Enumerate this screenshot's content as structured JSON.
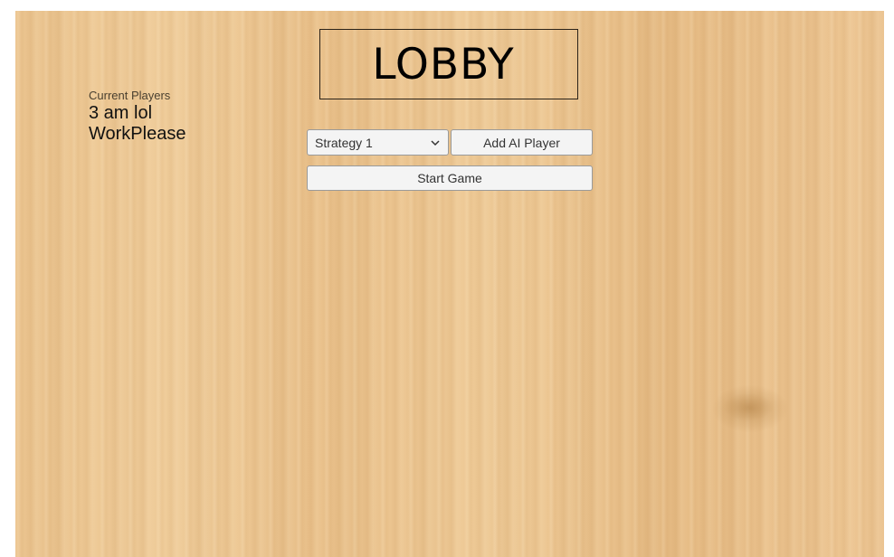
{
  "lobby": {
    "title": "LOBBY"
  },
  "players": {
    "heading": "Current Players",
    "names": [
      "3 am lol",
      "WorkPlease"
    ]
  },
  "controls": {
    "strategy_selected": "Strategy 1",
    "add_ai_label": "Add AI Player",
    "start_label": "Start Game"
  },
  "icons": {
    "dropdown": "chevron-down-icon"
  },
  "colors": {
    "background": "#ecc591",
    "button_face": "#f4f4f4",
    "button_border": "#9a9a9a",
    "title_border": "#2a2218"
  }
}
